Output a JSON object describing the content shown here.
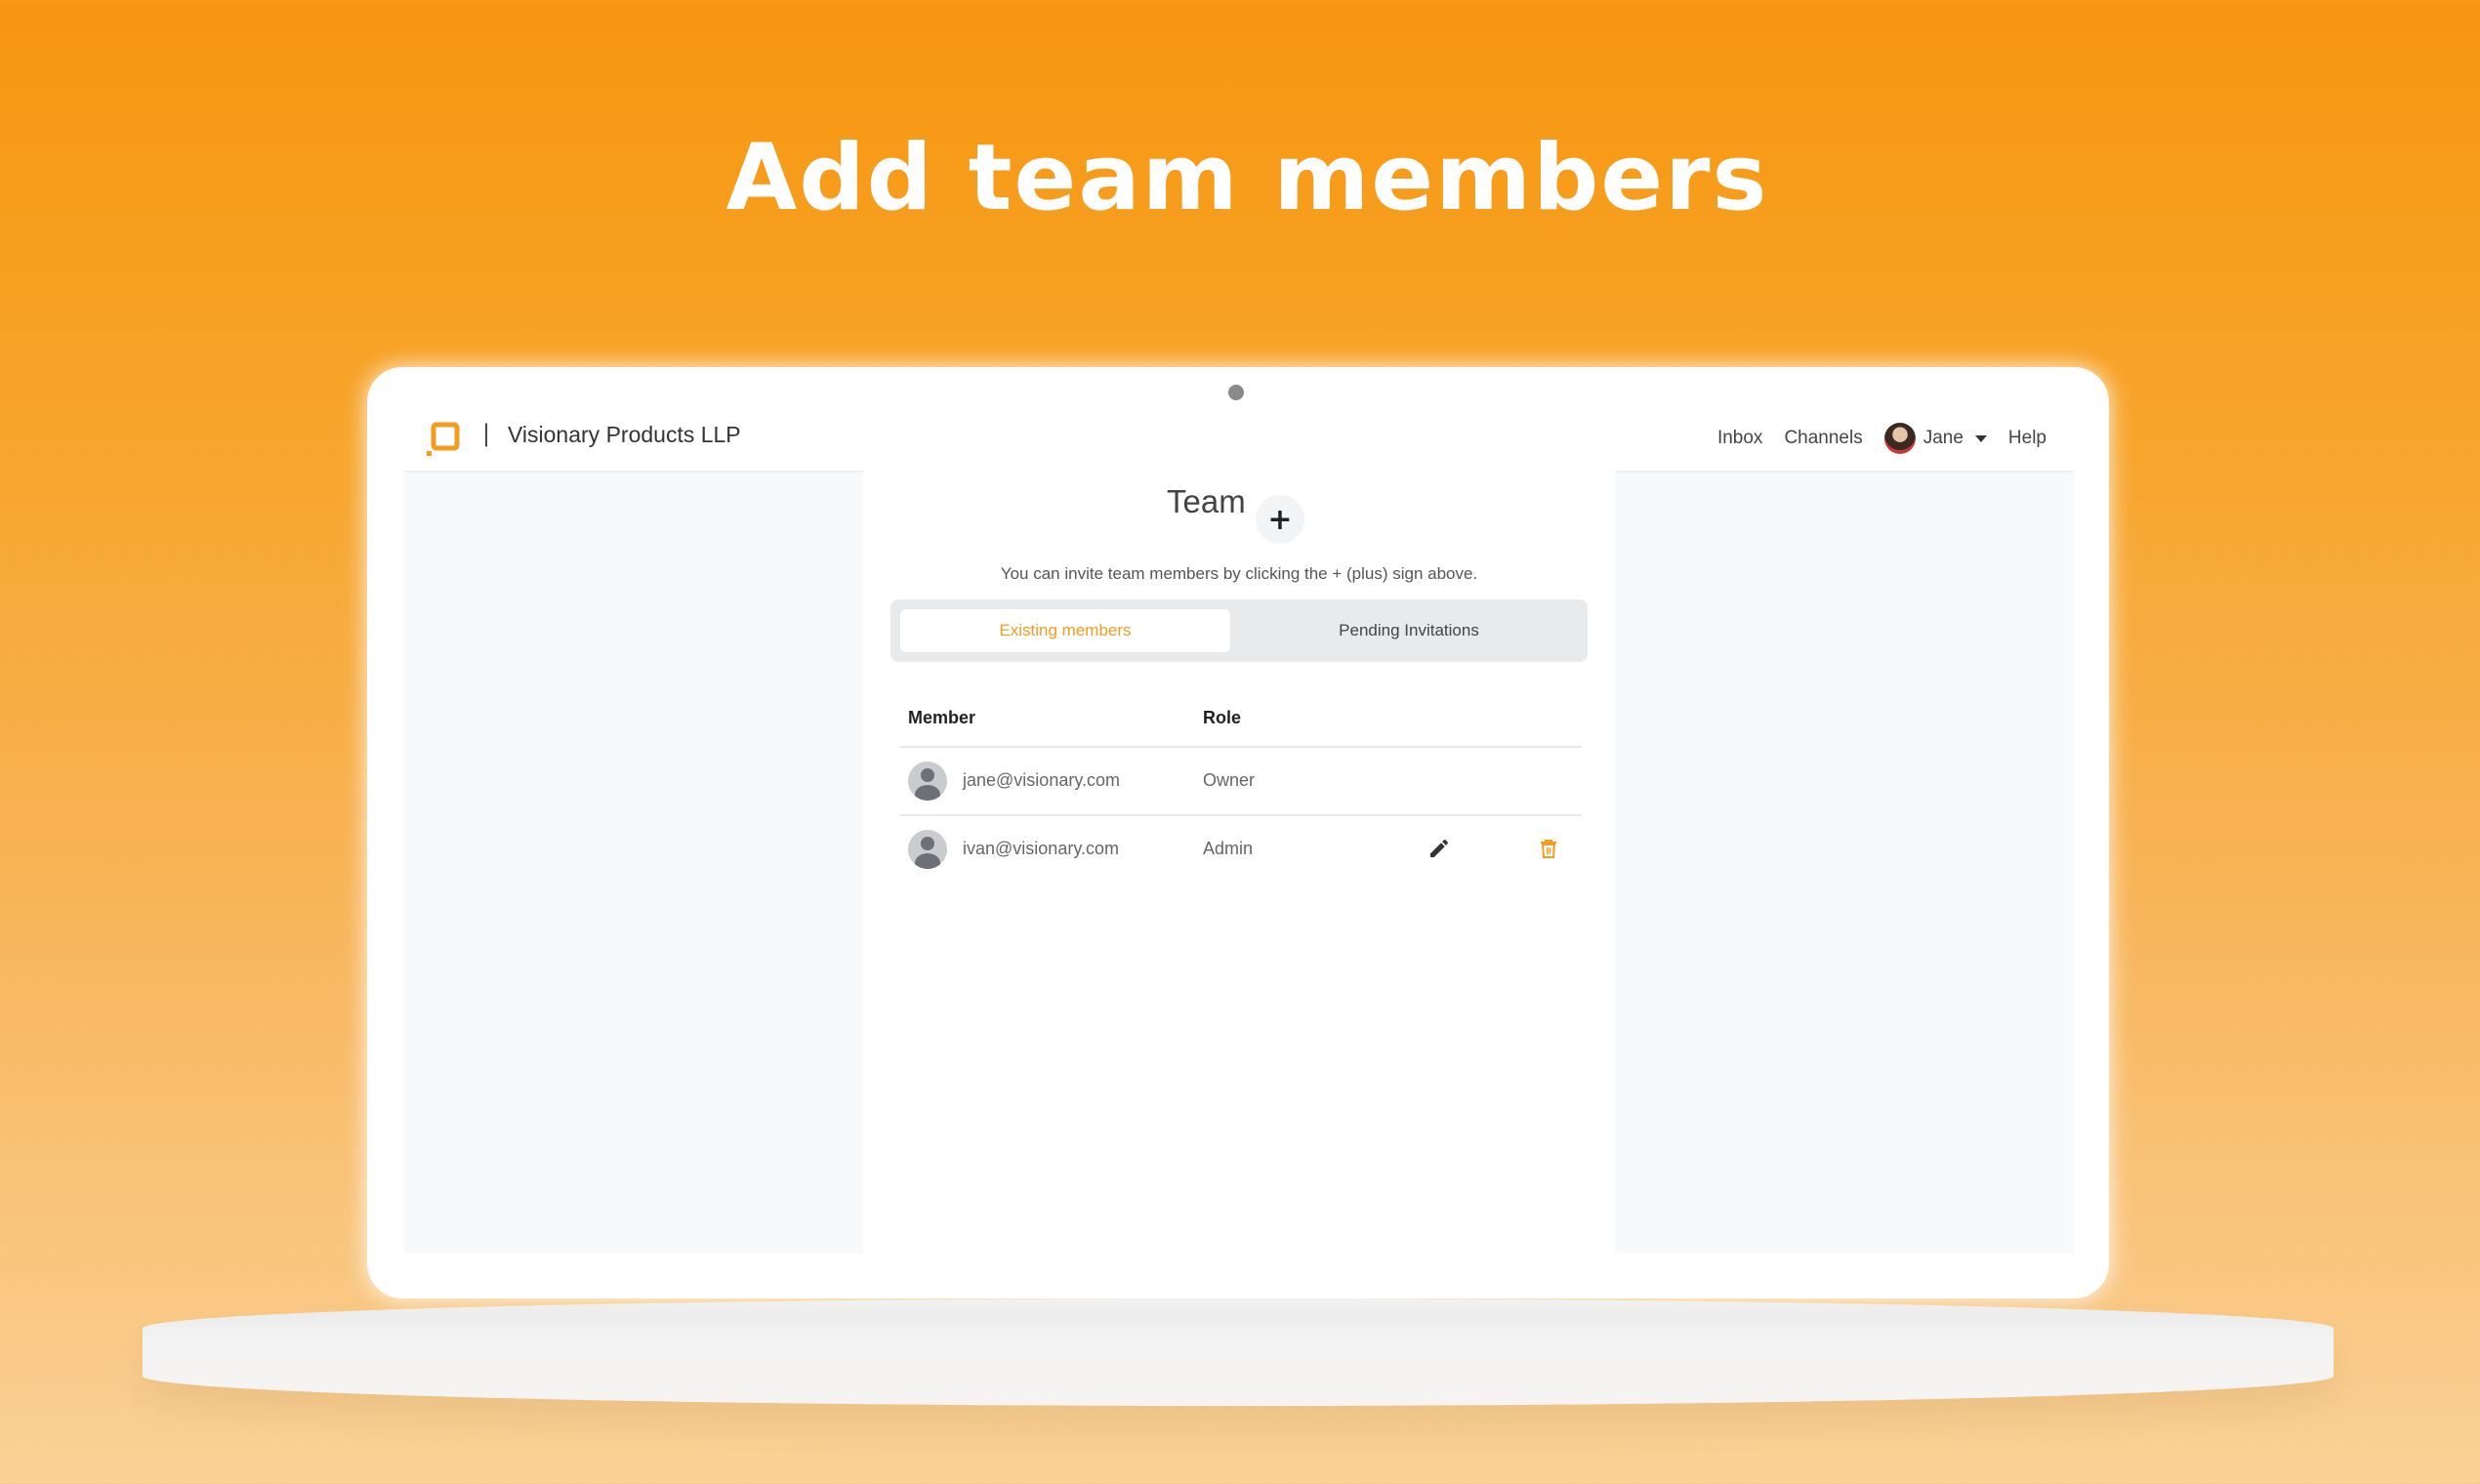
{
  "headline": "Add team members",
  "navbar": {
    "separator": "|",
    "company": "Visionary Products LLP",
    "links": {
      "inbox": "Inbox",
      "channels": "Channels",
      "help": "Help"
    },
    "user": {
      "name": "Jane"
    }
  },
  "team": {
    "title": "Team",
    "add_label": "+",
    "hint": "You can invite team members by clicking the + (plus) sign above.",
    "tabs": [
      {
        "label": "Existing members",
        "active": true
      },
      {
        "label": "Pending Invitations",
        "active": false
      }
    ],
    "table": {
      "headers": {
        "member": "Member",
        "role": "Role"
      },
      "rows": [
        {
          "email": "jane@visionary.com",
          "role": "Owner"
        },
        {
          "email": "ivan@visionary.com",
          "role": "Admin"
        }
      ]
    }
  },
  "colors": {
    "accent": "#f39c1e",
    "background_top": "#f7960f",
    "background_bottom": "#fad197"
  },
  "icons": [
    "logo-icon",
    "user-avatar-icon",
    "edit-icon",
    "delete-icon",
    "caret-down-icon",
    "plus-icon"
  ]
}
